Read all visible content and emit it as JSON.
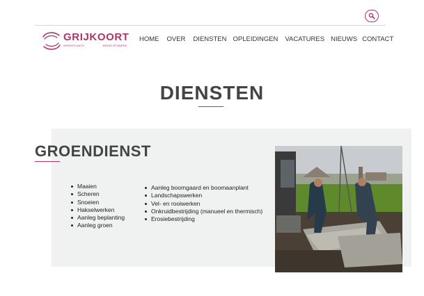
{
  "header": {
    "search_icon": "search-icon",
    "logo": {
      "name": "GRIJKOORT",
      "sub_left": "WERKPLAATS",
      "sub_right": "BEDRIJFSWERK"
    },
    "nav": [
      {
        "label": "HOME"
      },
      {
        "label": "OVER"
      },
      {
        "label": "DIENSTEN"
      },
      {
        "label": "OPLEIDINGEN"
      },
      {
        "label": "VACATURES"
      },
      {
        "label": "NIEUWS"
      },
      {
        "label": "CONTACT"
      }
    ]
  },
  "page": {
    "title": "DIENSTEN"
  },
  "section": {
    "title": "GROENDIENST",
    "list_left": [
      "Maaien",
      "Scheren",
      "Snoeien",
      "Hakselwerken",
      "Aanleg beplanting",
      "Aanleg groen"
    ],
    "list_right": [
      "Aanleg boomgaard en boomaanplant",
      "Landschapswerken",
      "Vel- en rooiwerken",
      "Onkruidbestrijding (manueel en thermisch)",
      "Erosiebestrijding"
    ]
  },
  "colors": {
    "accent": "#b0336b",
    "section_bg": "#f0f1f1",
    "text": "#333333"
  }
}
